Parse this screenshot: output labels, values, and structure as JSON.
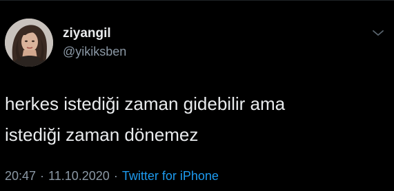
{
  "tweet": {
    "author": {
      "display_name": "ziyangil",
      "handle": "@yikiksben",
      "avatar_icon": "profile-photo"
    },
    "more_icon": "chevron-down-icon",
    "text_lines": [
      "herkes istediği zaman gidebilir ama",
      "istediği zaman dönemez"
    ],
    "meta": {
      "time": "20:47",
      "separator": "·",
      "date": "11.10.2020",
      "source": "Twitter for iPhone"
    }
  },
  "colors": {
    "background": "#000000",
    "primary_text": "#e9ebed",
    "secondary_text": "#8b98a5",
    "link": "#1d9bf0"
  }
}
